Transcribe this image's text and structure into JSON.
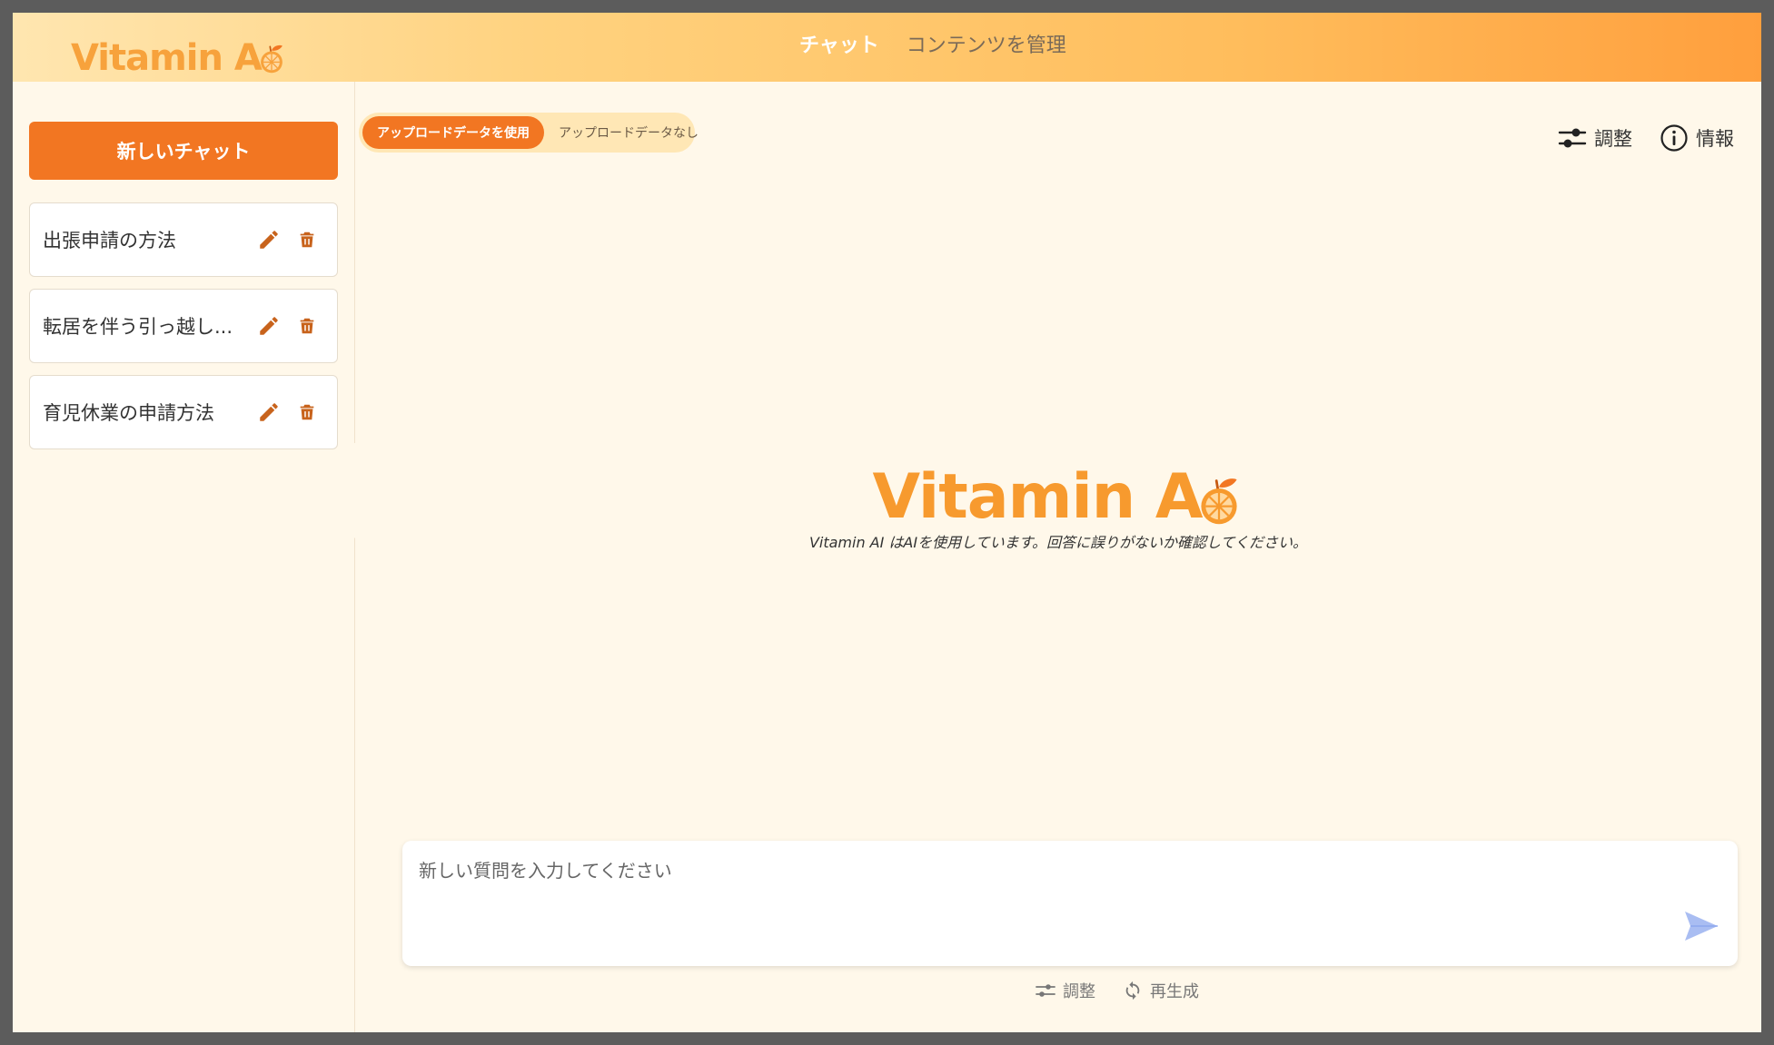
{
  "brand": {
    "name_text": "Vitamin A",
    "color": "#f7a23c"
  },
  "nav": {
    "tabs": [
      {
        "label": "チャット",
        "active": true
      },
      {
        "label": "コンテンツを管理",
        "active": false
      }
    ]
  },
  "sidebar": {
    "new_chat_label": "新しいチャット",
    "history": [
      {
        "label": "出張申請の方法"
      },
      {
        "label": "転居を伴う引っ越し..."
      },
      {
        "label": "育児休業の申請方法"
      }
    ],
    "accent_color": "#f27622"
  },
  "main": {
    "data_toggle": {
      "options": [
        {
          "label": "アップロードデータを使用",
          "active": true
        },
        {
          "label": "アップロードデータなし",
          "active": false
        }
      ]
    },
    "top_actions": {
      "adjust_label": "調整",
      "info_label": "情報"
    },
    "center": {
      "logo_text": "Vitamin A",
      "disclaimer": "Vitamin AI はAIを使用しています。回答に誤りがないか確認してください。"
    },
    "input": {
      "placeholder": "新しい質問を入力してください",
      "value": ""
    },
    "bottom_actions": {
      "adjust_label": "調整",
      "regenerate_label": "再生成"
    }
  },
  "icons": {
    "logo": "orange-icon",
    "edit": "pencil-icon",
    "delete": "trash-icon",
    "adjust": "sliders-icon",
    "info": "info-icon",
    "send": "send-icon",
    "regenerate": "refresh-icon"
  }
}
